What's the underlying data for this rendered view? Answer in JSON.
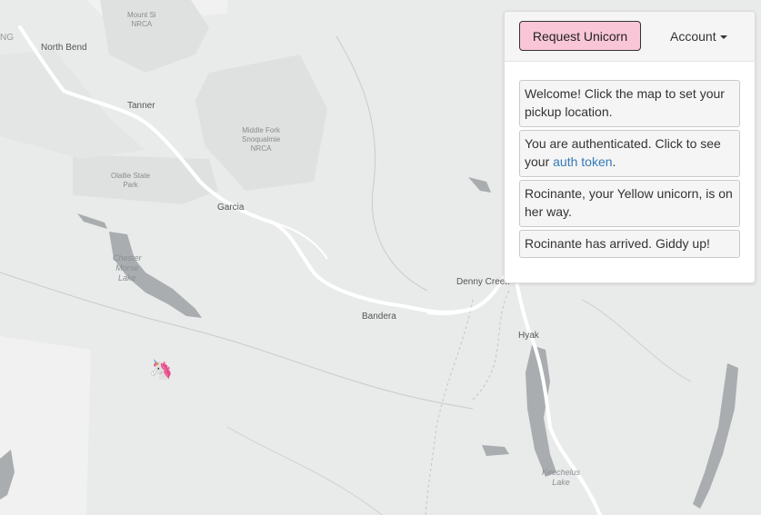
{
  "map": {
    "labels": {
      "north_bend": "North Bend",
      "mount_si_1": "Mount Si",
      "mount_si_2": "NRCA",
      "edge_label": "NG",
      "tanner": "Tanner",
      "middle_fork_1": "Middle Fork",
      "middle_fork_2": "Snoqualmie",
      "middle_fork_3": "NRCA",
      "olallie_1": "Olallie State",
      "olallie_2": "Park",
      "garcia": "Garcia",
      "chester_1": "Chester",
      "chester_2": "Morse",
      "chester_3": "Lake",
      "denny_creek": "Denny Creek",
      "bandera": "Bandera",
      "hyak": "Hyak",
      "keechelus_1": "Keechelus",
      "keechelus_2": "Lake"
    },
    "colors": {
      "land": "#e9eaea",
      "park": "#dfe1e1",
      "water": "#a9adaf",
      "road": "#ffffff",
      "light_area": "#f1f1f1"
    },
    "marker": {
      "icon": "unicorn-icon",
      "glyph": "🦄"
    }
  },
  "panel": {
    "request_button": "Request Unicorn",
    "account_label": "Account",
    "messages": {
      "m1": "Welcome! Click the map to set your pickup location.",
      "m2_text": "You are authenticated. Click to see your",
      "m2_link": "auth token",
      "m2_end": ".",
      "m3": "Rocinante, your Yellow unicorn, is on her way.",
      "m4": "Rocinante has arrived. Giddy up!"
    },
    "colors": {
      "button_bg": "#f8c6d7",
      "link": "#337ab7"
    }
  }
}
